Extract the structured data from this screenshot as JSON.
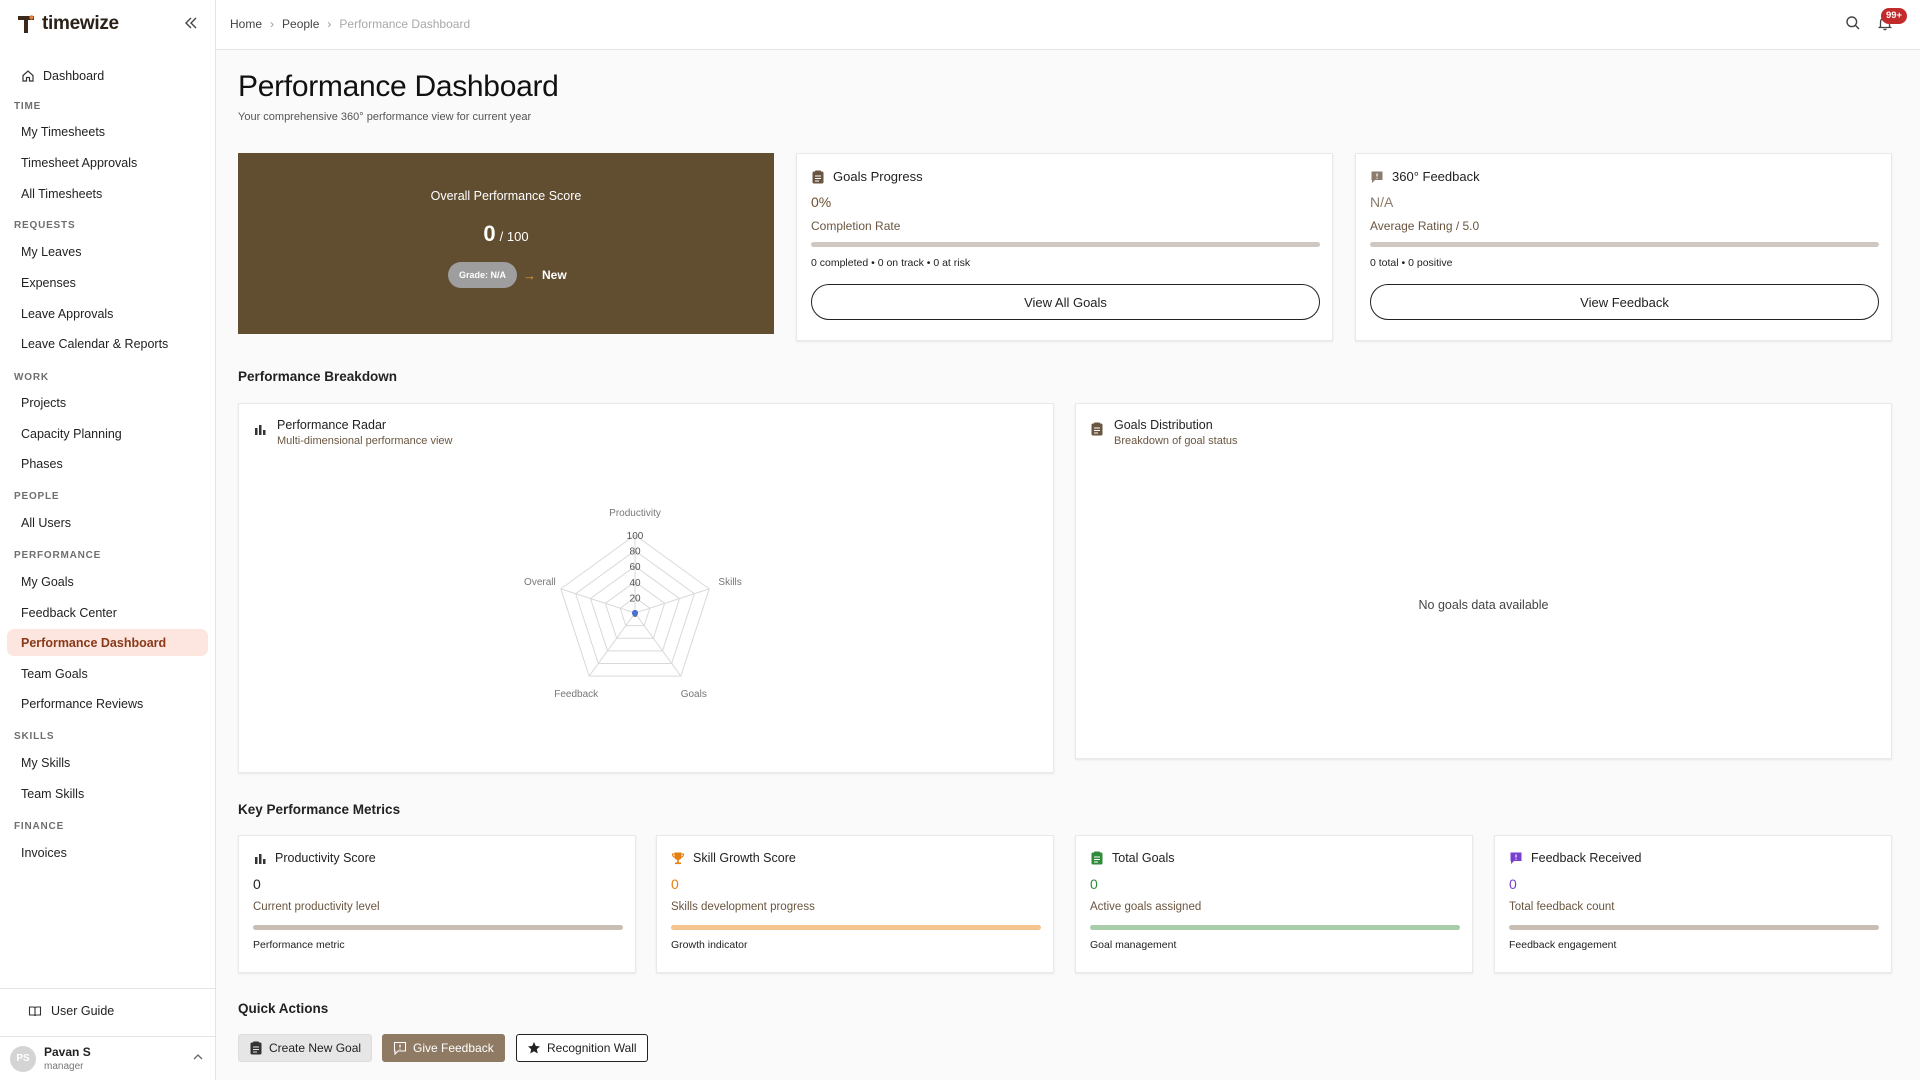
{
  "app": {
    "name": "timewize"
  },
  "nav": {
    "dashboard": "Dashboard",
    "sections": [
      {
        "heading": "TIME",
        "items": [
          "My Timesheets",
          "Timesheet Approvals",
          "All Timesheets"
        ]
      },
      {
        "heading": "REQUESTS",
        "items": [
          "My Leaves",
          "Expenses",
          "Leave Approvals",
          "Leave Calendar & Reports"
        ]
      },
      {
        "heading": "WORK",
        "items": [
          "Projects",
          "Capacity Planning",
          "Phases"
        ]
      },
      {
        "heading": "PEOPLE",
        "items": [
          "All Users"
        ]
      },
      {
        "heading": "PERFORMANCE",
        "items": [
          "My Goals",
          "Feedback Center",
          "Performance Dashboard",
          "Team Goals",
          "Performance Reviews"
        ]
      },
      {
        "heading": "SKILLS",
        "items": [
          "My Skills",
          "Team Skills"
        ]
      },
      {
        "heading": "FINANCE",
        "items": [
          "Invoices"
        ]
      }
    ],
    "active": "Performance Dashboard",
    "user_guide": "User Guide"
  },
  "user": {
    "initials": "PS",
    "name": "Pavan S",
    "role": "manager"
  },
  "header": {
    "breadcrumb": [
      "Home",
      "People",
      "Performance Dashboard"
    ],
    "notification_count": "99+"
  },
  "page": {
    "title": "Performance Dashboard",
    "subtitle": "Your comprehensive 360° performance view for current year"
  },
  "overall_score": {
    "title": "Overall Performance Score",
    "value": "0",
    "max": "/ 100",
    "grade": "Grade: N/A",
    "arrow": "→",
    "status": "New",
    "bg_color": "#614d30"
  },
  "goals_progress": {
    "title": "Goals Progress",
    "value": "0%",
    "label": "Completion Rate",
    "stats": "0 completed • 0 on track • 0 at risk",
    "button": "View All Goals",
    "accent": "#6a4f2e"
  },
  "feedback_360": {
    "title": "360° Feedback",
    "value": "N/A",
    "label": "Average Rating / 5.0",
    "stats": "0 total • 0 positive",
    "button": "View Feedback"
  },
  "sections": {
    "breakdown": "Performance Breakdown",
    "metrics": "Key Performance Metrics",
    "quick_actions": "Quick Actions"
  },
  "radar": {
    "title": "Performance Radar",
    "subtitle": "Multi-dimensional performance view"
  },
  "goals_distribution": {
    "title": "Goals Distribution",
    "subtitle": "Breakdown of goal status",
    "empty": "No goals data available"
  },
  "chart_data": {
    "type": "radar",
    "axes": [
      "Productivity",
      "Skills",
      "Goals",
      "Feedback",
      "Overall"
    ],
    "ticks": [
      0,
      20,
      40,
      60,
      80,
      100
    ],
    "rlim": [
      0,
      100
    ],
    "values": [
      0,
      0,
      0,
      0,
      0
    ],
    "series_color": "#4a6fd1"
  },
  "metrics": [
    {
      "title": "Productivity Score",
      "value": "0",
      "label": "Current productivity level",
      "foot": "Performance metric",
      "color": "#222222",
      "bar_color": "#c8beb4",
      "icon": "bar-chart-icon"
    },
    {
      "title": "Skill Growth Score",
      "value": "0",
      "label": "Skills development progress",
      "foot": "Growth indicator",
      "color": "#e3800f",
      "bar_color": "#f5c48e",
      "icon": "trophy-icon"
    },
    {
      "title": "Total Goals",
      "value": "0",
      "label": "Active goals assigned",
      "foot": "Goal management",
      "color": "#2e8b3a",
      "bar_color": "#a9ccab",
      "icon": "clipboard-icon"
    },
    {
      "title": "Feedback Received",
      "value": "0",
      "label": "Total feedback count",
      "foot": "Feedback engagement",
      "color": "#7a3fd0",
      "bar_color": "#c8beb4",
      "icon": "feedback-icon"
    }
  ],
  "quick_actions": {
    "create_goal": "Create New Goal",
    "give_feedback": "Give Feedback",
    "recognition_wall": "Recognition Wall"
  }
}
